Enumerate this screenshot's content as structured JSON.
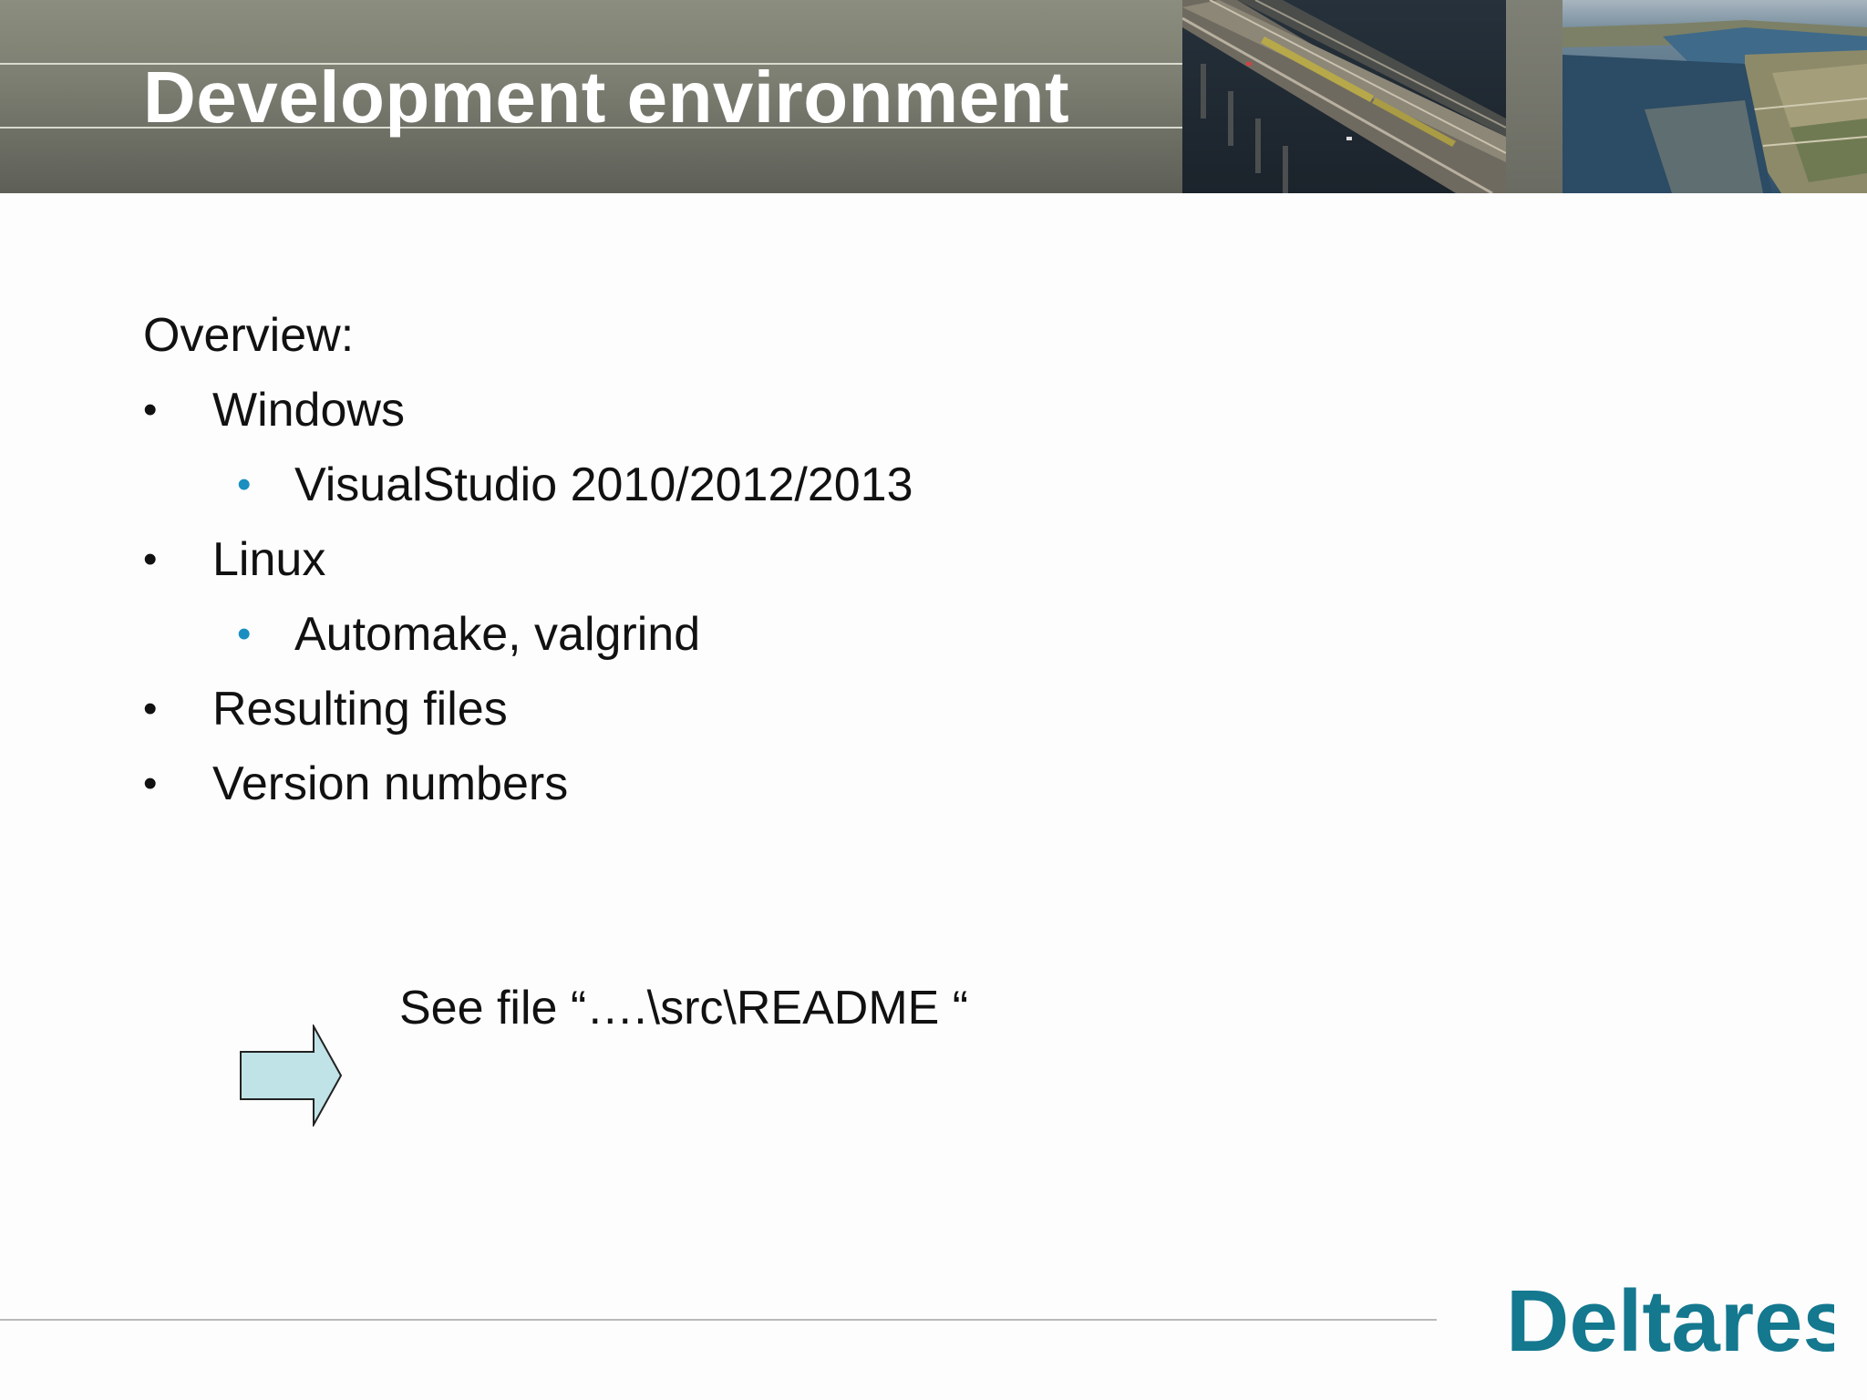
{
  "slide": {
    "title": "Development environment",
    "overview_label": "Overview:",
    "bullets": [
      {
        "text": "Windows",
        "level": 1
      },
      {
        "text": "VisualStudio 2010/2012/2013",
        "level": 2
      },
      {
        "text": "Linux",
        "level": 1
      },
      {
        "text": "Automake, valgrind",
        "level": 2
      },
      {
        "text": "Resulting files",
        "level": 1
      },
      {
        "text": "Version numbers",
        "level": 1
      }
    ],
    "bullet_glyph": "•",
    "see_file_text": "See file “….\\src\\README “",
    "logo_text": "Deltares"
  },
  "colors": {
    "header_band": "#7d7f72",
    "title_text": "#ffffff",
    "body_text": "#111111",
    "sub_bullet": "#1b8fc0",
    "arrow_fill": "#bfe3e6",
    "logo": "#14788f"
  },
  "icons": {
    "arrow": "right-arrow-icon"
  }
}
